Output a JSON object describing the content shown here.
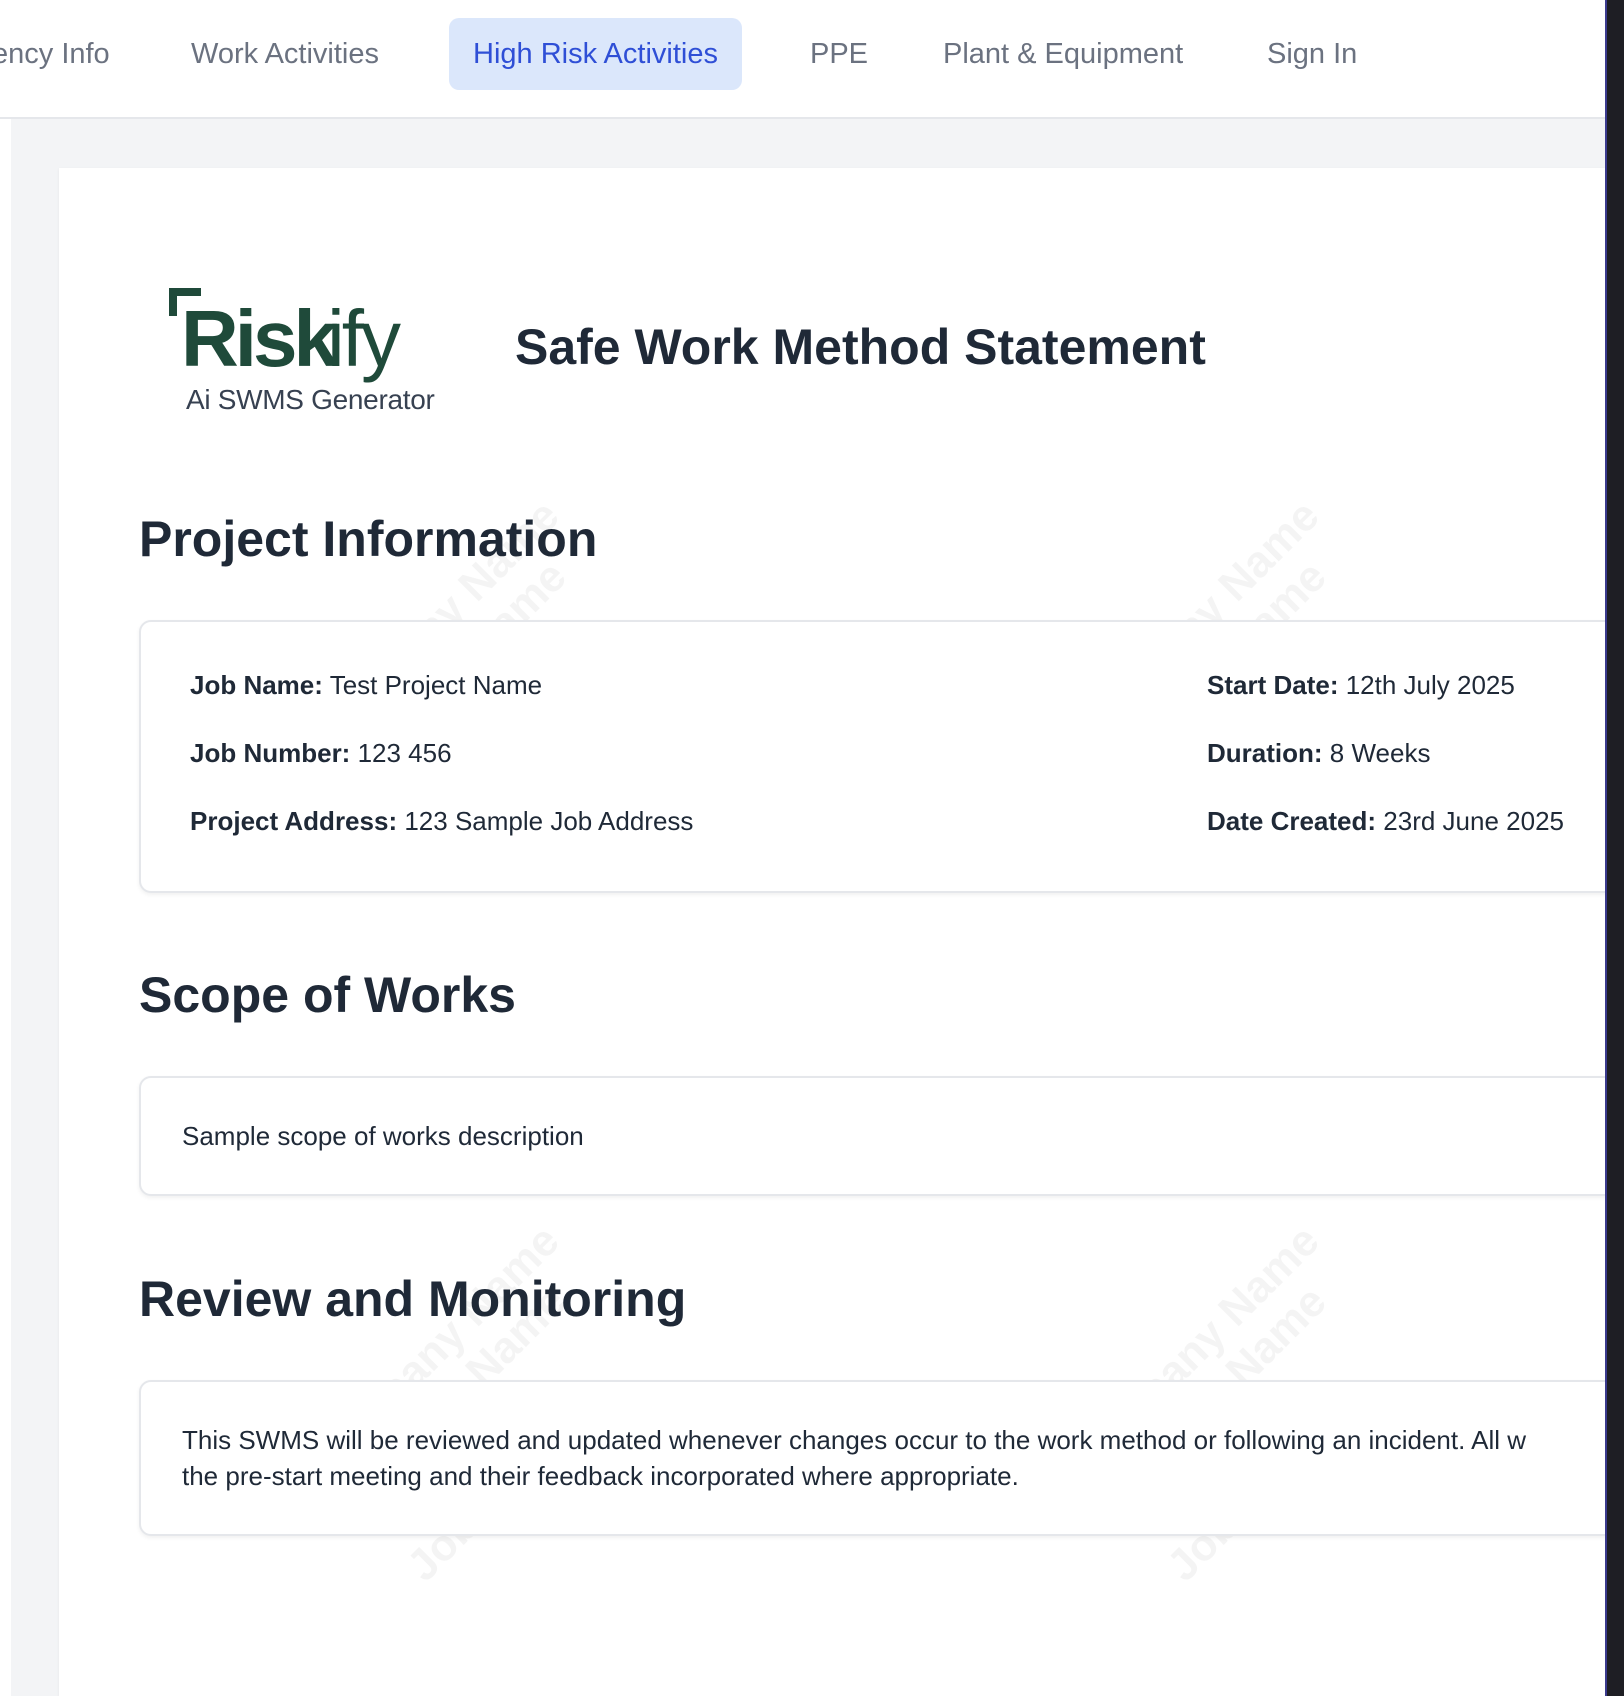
{
  "nav": {
    "tabs": [
      {
        "label": "ency Info"
      },
      {
        "label": "Work Activities"
      },
      {
        "label": "High Risk Activities",
        "active": true
      },
      {
        "label": "PPE"
      },
      {
        "label": "Plant & Equipment"
      },
      {
        "label": "Sign In"
      }
    ]
  },
  "logo": {
    "wordmark": "Riskify",
    "tagline": "Ai SWMS Generator"
  },
  "document": {
    "title": "Safe Work Method Statement"
  },
  "watermark": {
    "lines": [
      "est Company Name",
      "st Project Name",
      "123 456",
      "Job Address"
    ]
  },
  "project_info": {
    "heading": "Project Information",
    "left": [
      {
        "label": "Job Name:",
        "value": "Test Project Name"
      },
      {
        "label": "Job Number:",
        "value": "123 456"
      },
      {
        "label": "Project Address:",
        "value": "123 Sample Job Address"
      }
    ],
    "right": [
      {
        "label": "Start Date:",
        "value": "12th July 2025"
      },
      {
        "label": "Duration:",
        "value": "8 Weeks"
      },
      {
        "label": "Date Created:",
        "value": "23rd June 2025"
      }
    ]
  },
  "scope": {
    "heading": "Scope of Works",
    "text": "Sample scope of works description"
  },
  "review": {
    "heading": "Review and Monitoring",
    "line1": "This SWMS will be reviewed and updated whenever changes occur to the work method or following an incident. All w",
    "line2": "the pre-start meeting and their feedback incorporated where appropriate."
  },
  "colors": {
    "active_tab_bg": "#dbe7fb",
    "active_tab_text": "#2f4fd6",
    "logo_green": "#1f4a3a"
  }
}
